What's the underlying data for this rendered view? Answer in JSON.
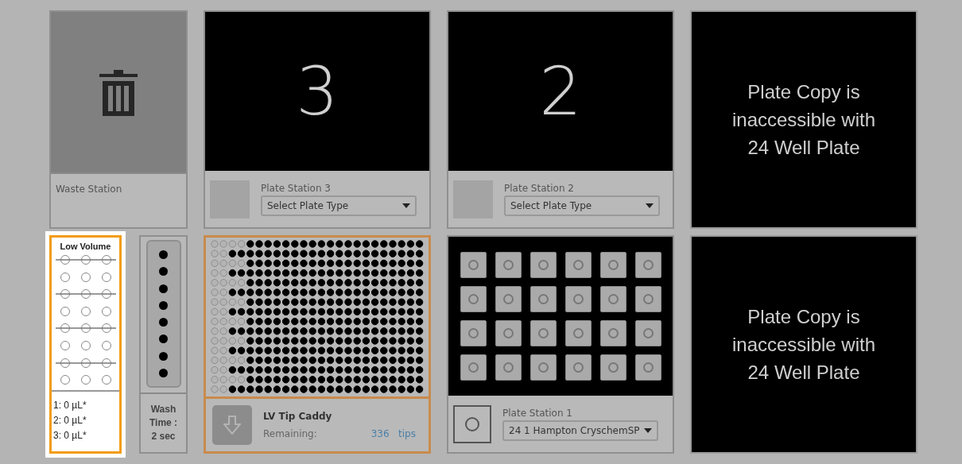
{
  "waste_station": {
    "label": "Waste Station"
  },
  "plate_stations": [
    {
      "number": "3",
      "label": "Plate Station 3",
      "dropdown": "Select Plate Type"
    },
    {
      "number": "2",
      "label": "Plate Station 2",
      "dropdown": "Select Plate Type"
    }
  ],
  "plate_copy_messages": [
    "Plate Copy is inaccessible with 24 Well Plate",
    "Plate Copy is inaccessible with 24 Well Plate"
  ],
  "low_volume": {
    "title": "Low Volume",
    "rows": [
      {
        "struck": true
      },
      {
        "struck": false
      },
      {
        "struck": true
      },
      {
        "struck": false
      },
      {
        "struck": true
      },
      {
        "struck": false
      },
      {
        "struck": true
      },
      {
        "struck": false
      }
    ],
    "readings": [
      "1: 0 µL*",
      "2: 0 µL*",
      "3: 0 µL*"
    ]
  },
  "wash": {
    "label": "Wash Time : 2 sec"
  },
  "tip_caddy": {
    "name": "LV Tip Caddy",
    "remaining_label": "Remaining:",
    "count": "336",
    "unit": "tips"
  },
  "plate_station_1": {
    "label": "Plate Station 1",
    "dropdown": "24 1 Hampton CryschemSP"
  }
}
